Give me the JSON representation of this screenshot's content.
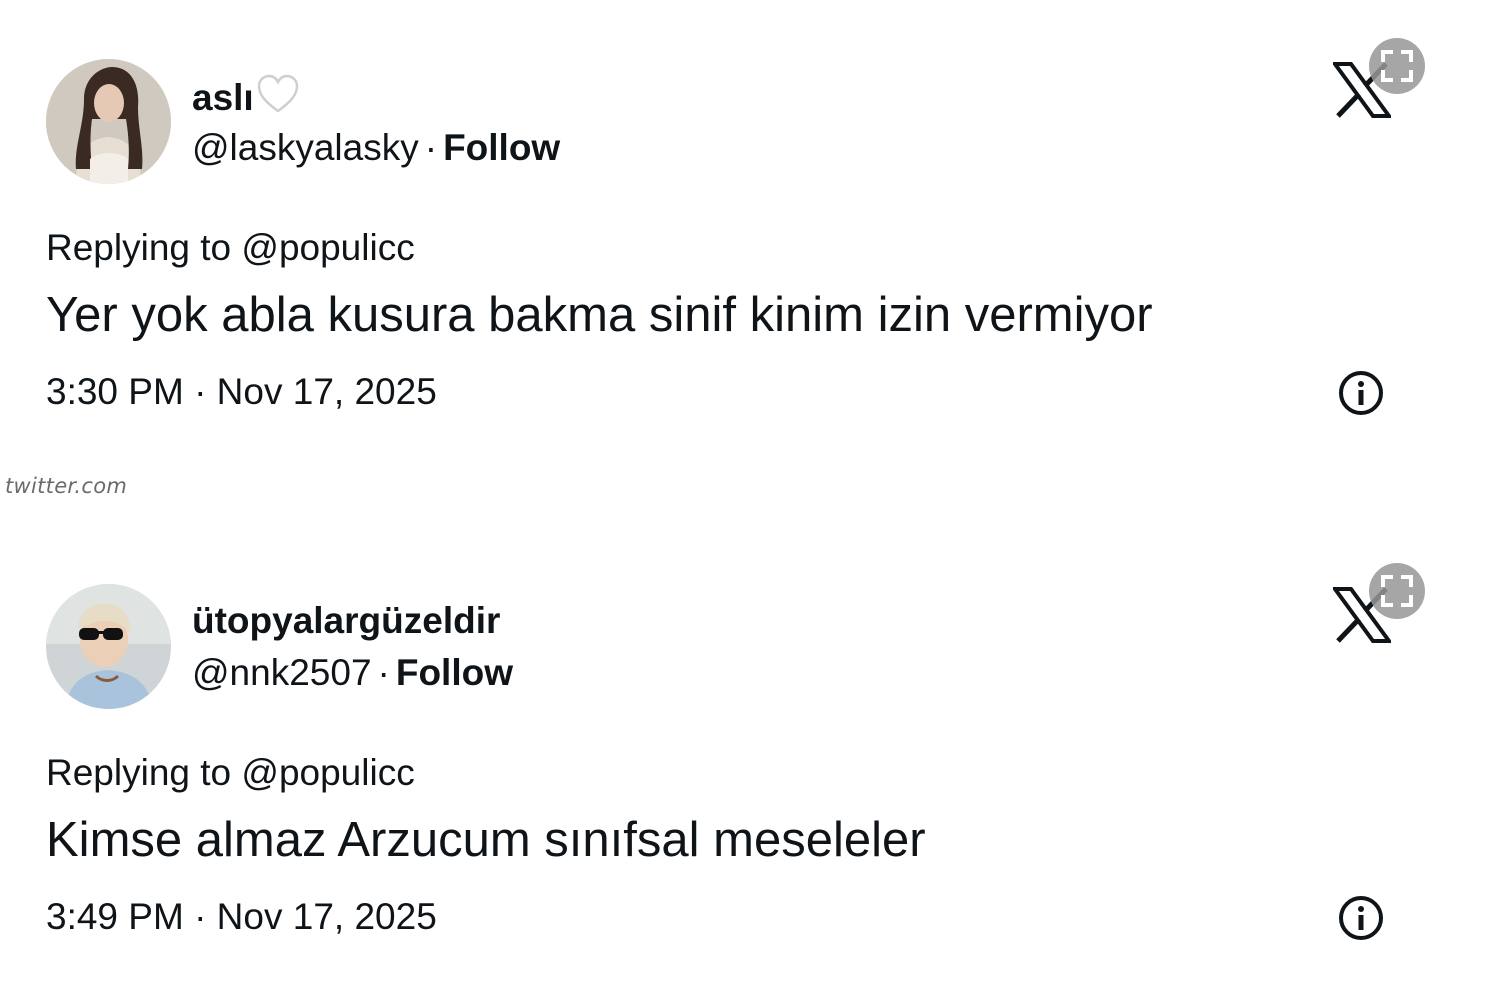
{
  "source_label": "twitter.com",
  "tweets": [
    {
      "display_name": "aslı",
      "display_emoji": "🤍",
      "handle": "@laskyalasky",
      "separator": "·",
      "follow_label": "Follow",
      "replying_to": "Replying to @populicc",
      "text": "Yer yok abla kusura bakma sinif kinim izin vermiyor",
      "timestamp": "3:30 PM · Nov 17, 2025"
    },
    {
      "display_name": "ütopyalargüzeldir",
      "handle": "@nnk2507",
      "separator": "·",
      "follow_label": "Follow",
      "replying_to": "Replying to @populicc",
      "text": "Kimse almaz Arzucum sınıfsal meseleler",
      "timestamp": "3:49 PM · Nov 17, 2025"
    }
  ],
  "icons": {
    "brand": "x-logo-icon",
    "expand": "expand-icon",
    "info": "info-icon",
    "heart": "white-heart-icon"
  },
  "colors": {
    "text": "#0f1419",
    "source_text": "#6b6b6b",
    "expand_button_bg": "#969696"
  }
}
